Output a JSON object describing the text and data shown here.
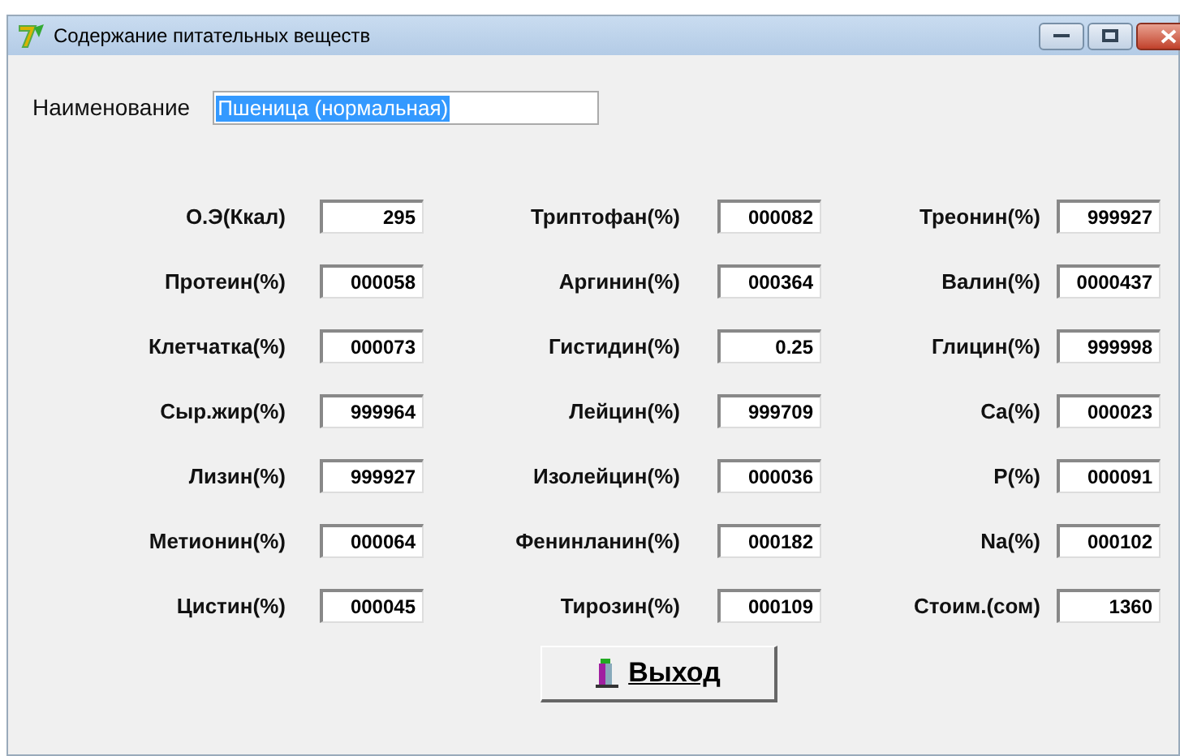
{
  "window": {
    "title": "Содержание питательных веществ"
  },
  "name_field": {
    "label": "Наименование",
    "value": "Пшеница (нормальная)"
  },
  "fields": [
    {
      "label": "О.Э(Ккал)",
      "value": "295"
    },
    {
      "label": "Триптофан(%)",
      "value": "000082"
    },
    {
      "label": "Треонин(%)",
      "value": "999927"
    },
    {
      "label": "Протеин(%)",
      "value": "000058"
    },
    {
      "label": "Аргинин(%)",
      "value": "000364"
    },
    {
      "label": "Валин(%)",
      "value": "0000437"
    },
    {
      "label": "Клетчатка(%)",
      "value": "000073"
    },
    {
      "label": "Гистидин(%)",
      "value": "0.25"
    },
    {
      "label": "Глицин(%)",
      "value": "999998"
    },
    {
      "label": "Сыр.жир(%)",
      "value": "999964"
    },
    {
      "label": "Лейцин(%)",
      "value": "999709"
    },
    {
      "label": "Ca(%)",
      "value": "000023"
    },
    {
      "label": "Лизин(%)",
      "value": "999927"
    },
    {
      "label": "Изолейцин(%)",
      "value": "000036"
    },
    {
      "label": "P(%)",
      "value": "000091"
    },
    {
      "label": "Метионин(%)",
      "value": "000064"
    },
    {
      "label": "Фенинланин(%)",
      "value": "000182"
    },
    {
      "label": "Na(%)",
      "value": "000102"
    },
    {
      "label": "Цистин(%)",
      "value": "000045"
    },
    {
      "label": "Тирозин(%)",
      "value": "000109"
    },
    {
      "label": "Стоим.(сом)",
      "value": "1360"
    }
  ],
  "exit_button": {
    "label": "Выход"
  }
}
